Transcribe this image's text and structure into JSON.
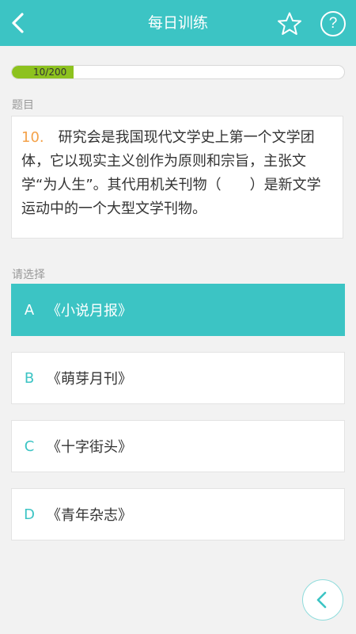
{
  "header": {
    "title": "每日训练",
    "back_icon": "chevron-left-icon",
    "favorite_icon": "star-outline-icon",
    "help_icon": "question-circle-icon",
    "help_glyph": "?"
  },
  "progress": {
    "text": "10/200",
    "current": 10,
    "total": 200,
    "fill_color": "#8dc21f"
  },
  "question_section": {
    "label": "题目",
    "number": "10.",
    "text": "研究会是我国现代文学史上第一个文学团体，它以现实主义创作为原则和宗旨，主张文学“为人生”。其代用机关刊物（　　）是新文学运动中的一个大型文学刊物。"
  },
  "options_section": {
    "label": "请选择",
    "options": [
      {
        "letter": "A",
        "text": "《小说月报》",
        "selected": true
      },
      {
        "letter": "B",
        "text": "《萌芽月刊》",
        "selected": false
      },
      {
        "letter": "C",
        "text": "《十字街头》",
        "selected": false
      },
      {
        "letter": "D",
        "text": "《青年杂志》",
        "selected": false
      }
    ]
  },
  "floating_button": {
    "icon": "chevron-left-icon"
  },
  "colors": {
    "accent": "#3cc4c4",
    "question_number": "#f4a24a",
    "background": "#f2f2f2"
  }
}
